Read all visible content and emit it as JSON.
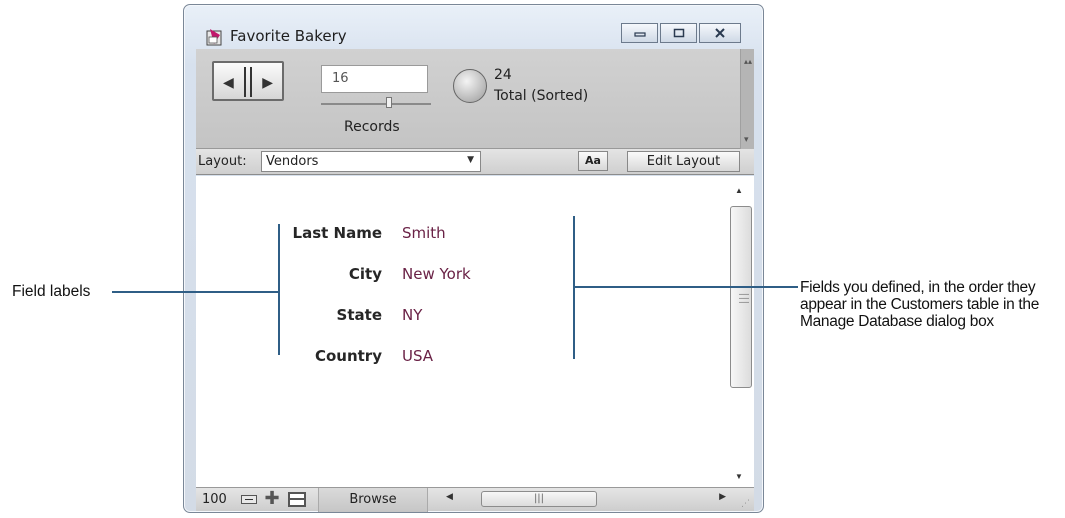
{
  "window": {
    "title": "Favorite Bakery",
    "controls": {
      "minimize": "–",
      "maximize": "□",
      "close": "✕"
    }
  },
  "toolbar": {
    "record_number": "16",
    "records_label": "Records",
    "found_count": "24",
    "found_status": "Total (Sorted)"
  },
  "layout_bar": {
    "label": "Layout:",
    "selected_layout": "Vendors",
    "text_format_button": "Aa",
    "edit_layout_button": "Edit Layout"
  },
  "fields": [
    {
      "label": "Last Name",
      "value": "Smith"
    },
    {
      "label": "City",
      "value": "New York"
    },
    {
      "label": "State",
      "value": "NY"
    },
    {
      "label": "Country",
      "value": "USA"
    }
  ],
  "bottom_bar": {
    "zoom_level": "100",
    "mode": "Browse"
  },
  "annotations": {
    "left": "Field labels",
    "right": "Fields you defined, in the order they appear in the Customers table in the Manage Database dialog box"
  },
  "colors": {
    "callout_line": "#2f5e86",
    "field_value_text": "#6a2246"
  }
}
